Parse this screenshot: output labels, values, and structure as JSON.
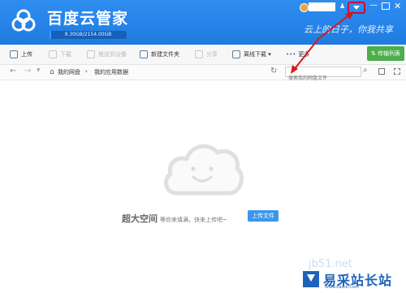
{
  "header": {
    "title": "百度云管家",
    "quota_text": "9.30GB/2154.00GB",
    "quota_fraction": 0.0043,
    "slogan": "云上的日子，你我共享",
    "brand_color": "#1f7be0"
  },
  "toolbar": {
    "upload": "上传",
    "download": "下载",
    "push": "推送到设备",
    "new_folder": "新建文件夹",
    "share": "分享",
    "offline": "离线下载",
    "more": "更多",
    "transfer": "传输列表"
  },
  "address": {
    "crumbs": [
      "我的网盘",
      "我的应用数据"
    ],
    "search_placeholder": "搜索我的网盘文件"
  },
  "empty": {
    "big": "超大空间",
    "sub": "等你来填满，快来上传吧~",
    "button": "上传文件"
  },
  "watermark": {
    "url": "jb51.net",
    "name": "易采站长站",
    "sub": "Www.Easck.Com"
  }
}
